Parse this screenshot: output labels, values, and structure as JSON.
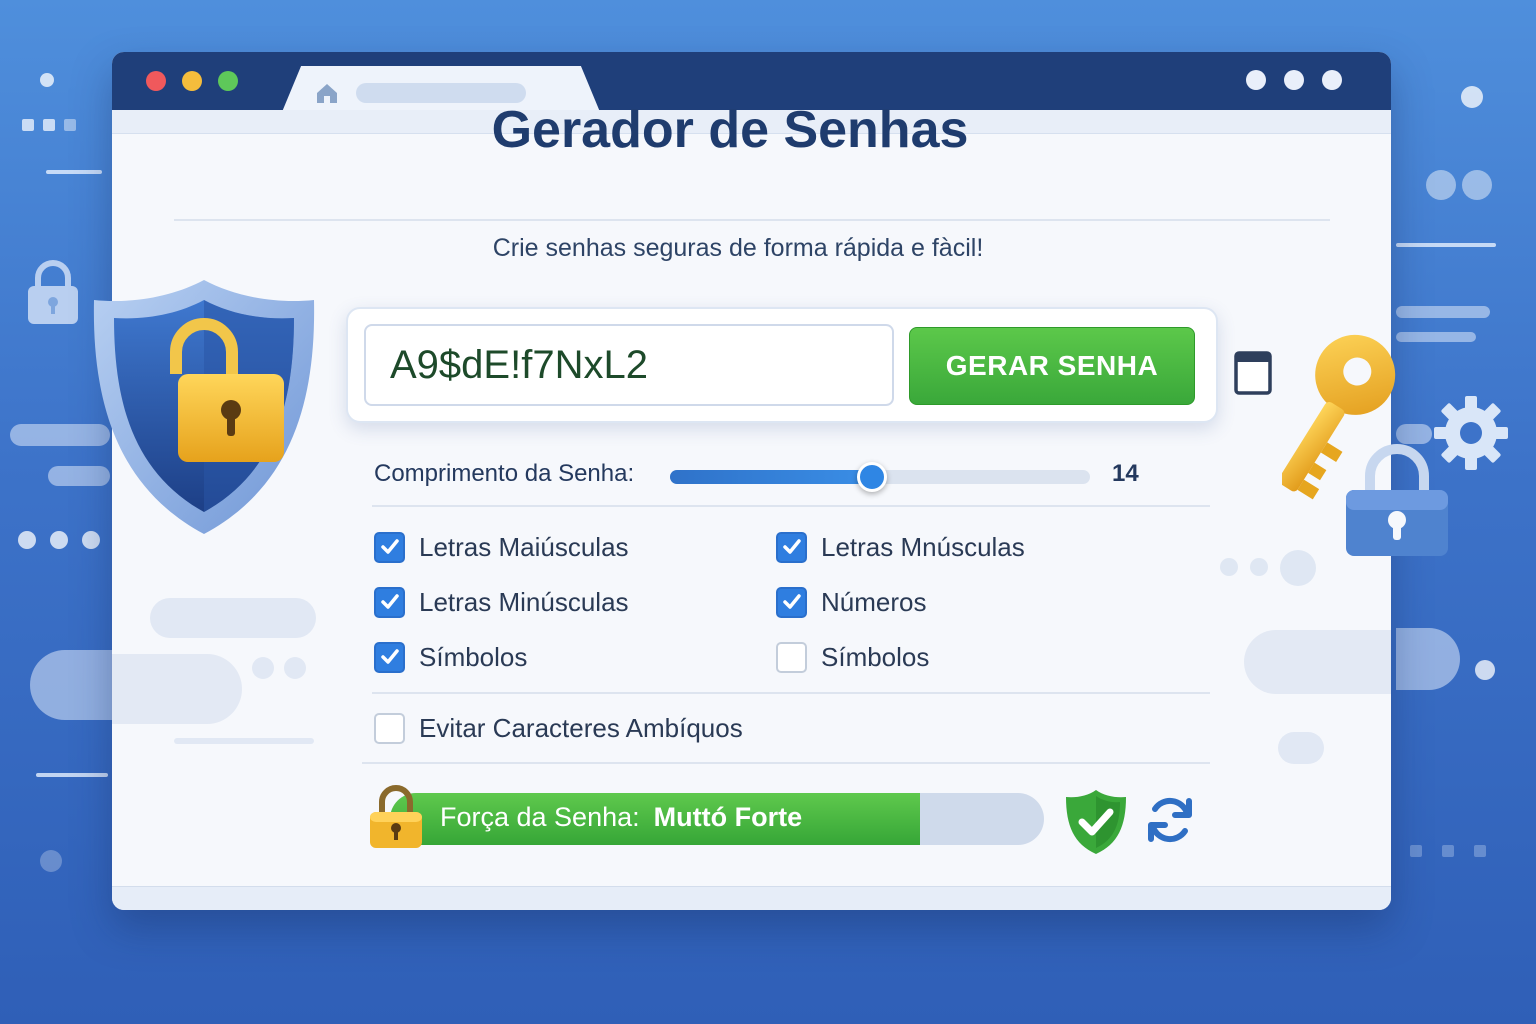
{
  "app": {
    "title": "Gerador de Senhas",
    "subtitle": "Crie senhas seguras de forma rápida e fàcil!"
  },
  "password": {
    "value": "A9$dE!f7NxL2",
    "generate_label": "GERAR SENHA"
  },
  "length": {
    "label": "Comprimento da Senha:",
    "value": "14",
    "slider_fraction": 0.48
  },
  "options": [
    {
      "label": "Letras Maiúsculas",
      "checked": true
    },
    {
      "label": "Letras Mnúsculas",
      "checked": true
    },
    {
      "label": "Letras Minúsculas",
      "checked": true
    },
    {
      "label": "Números",
      "checked": true
    },
    {
      "label": "Símbolos",
      "checked": true
    },
    {
      "label": "Símbolos",
      "checked": false
    }
  ],
  "avoid_ambiguous": {
    "label": "Evitar Caracteres Ambíquos",
    "checked": false
  },
  "strength": {
    "label": "Força da Senha:",
    "value": "Muttó Forte",
    "fraction": 0.81
  },
  "colors": {
    "accent_blue": "#2f7ee0",
    "success_green": "#3aa83a",
    "title_navy": "#1f3c6e"
  },
  "icons": [
    "home-icon",
    "copy-icon",
    "lock-icon",
    "shield-check-icon",
    "refresh-icon",
    "key-icon",
    "gear-icon",
    "shield-lock-icon"
  ]
}
